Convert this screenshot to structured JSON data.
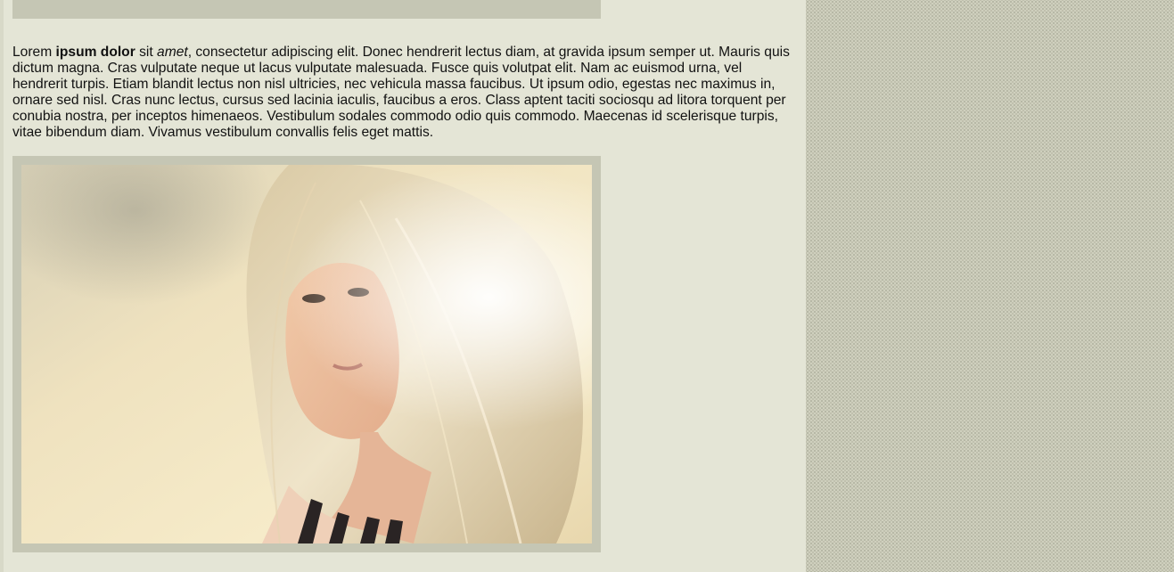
{
  "article": {
    "paragraph": {
      "lead": "Lorem ",
      "bold": "ipsum dolor",
      "middle": " sit ",
      "italic": "amet",
      "rest": ", consectetur adipiscing elit. Donec hendrerit lectus diam, at gravida ipsum semper ut. Mauris quis dictum magna. Cras vulputate neque ut lacus vulputate malesuada. Fusce quis volutpat elit. Nam ac euismod urna, vel hendrerit turpis. Etiam blandit lectus non nisl ultricies, nec vehicula massa faucibus. Ut ipsum odio, egestas nec maximus in, ornare sed nisl. Cras nunc lectus, cursus sed lacinia iaculis, faucibus a eros. Class aptent taciti sociosqu ad litora torquent per conubia nostra, per inceptos himenaeos. Vestibulum sodales commodo odio quis commodo. Maecenas id scelerisque turpis, vitae bibendum diam. Vivamus vestibulum convallis felis eget mattis."
    }
  },
  "colors": {
    "content_background": "#e4e5d6",
    "page_background": "#cfd0be",
    "photo_frame": "#c5c6b4",
    "text": "#111111"
  }
}
